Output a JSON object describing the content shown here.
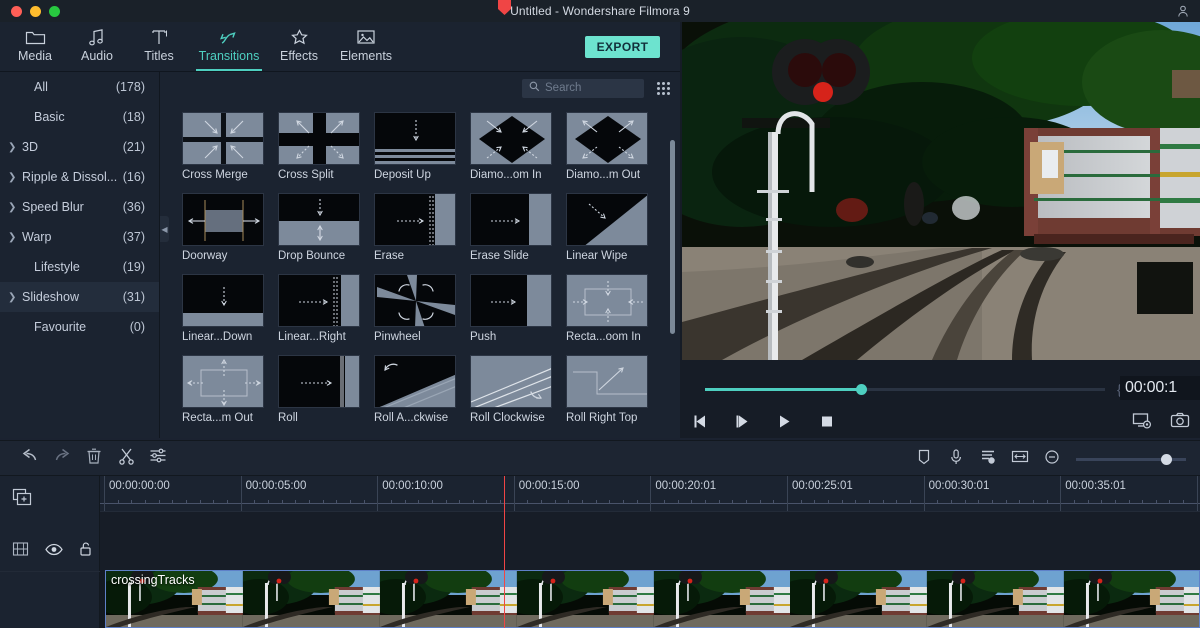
{
  "window": {
    "title": "Untitled - Wondershare Filmora 9",
    "account_icon": "account-icon"
  },
  "nav": {
    "tabs": [
      {
        "label": "Media",
        "icon": "folder-icon",
        "active": false
      },
      {
        "label": "Audio",
        "icon": "music-note-icon",
        "active": false
      },
      {
        "label": "Titles",
        "icon": "text-t-icon",
        "active": false
      },
      {
        "label": "Transitions",
        "icon": "transition-arrows-icon",
        "active": true
      },
      {
        "label": "Effects",
        "icon": "sparkle-icon",
        "active": false
      },
      {
        "label": "Elements",
        "icon": "picture-icon",
        "active": false
      }
    ],
    "export_label": "EXPORT",
    "export_color": "#6de3cf"
  },
  "sidebar": {
    "items": [
      {
        "label": "All",
        "count": "(178)",
        "expandable": false,
        "selected": false
      },
      {
        "label": "Basic",
        "count": "(18)",
        "expandable": false,
        "selected": false
      },
      {
        "label": "3D",
        "count": "(21)",
        "expandable": true,
        "selected": false
      },
      {
        "label": "Ripple & Dissol...",
        "count": "(16)",
        "expandable": true,
        "selected": false
      },
      {
        "label": "Speed Blur",
        "count": "(36)",
        "expandable": true,
        "selected": false
      },
      {
        "label": "Warp",
        "count": "(37)",
        "expandable": true,
        "selected": false
      },
      {
        "label": "Lifestyle",
        "count": "(19)",
        "expandable": false,
        "selected": false
      },
      {
        "label": "Slideshow",
        "count": "(31)",
        "expandable": true,
        "selected": true
      },
      {
        "label": "Favourite",
        "count": "(0)",
        "expandable": false,
        "selected": false
      }
    ]
  },
  "search": {
    "placeholder": "Search",
    "value": ""
  },
  "transitions": [
    {
      "label": "Cross Merge",
      "art": "cross-merge"
    },
    {
      "label": "Cross Split",
      "art": "cross-split"
    },
    {
      "label": "Deposit Up",
      "art": "deposit-up"
    },
    {
      "label": "Diamo...om In",
      "art": "diamond-zoom-in"
    },
    {
      "label": "Diamo...m Out",
      "art": "diamond-zoom-out"
    },
    {
      "label": "Doorway",
      "art": "doorway"
    },
    {
      "label": "Drop Bounce",
      "art": "drop-bounce"
    },
    {
      "label": "Erase",
      "art": "erase"
    },
    {
      "label": "Erase Slide",
      "art": "erase-slide"
    },
    {
      "label": "Linear Wipe",
      "art": "linear-wipe"
    },
    {
      "label": "Linear...Down",
      "art": "linear-down"
    },
    {
      "label": "Linear...Right",
      "art": "linear-right"
    },
    {
      "label": "Pinwheel",
      "art": "pinwheel"
    },
    {
      "label": "Push",
      "art": "push"
    },
    {
      "label": "Recta...oom In",
      "art": "rect-zoom-in"
    },
    {
      "label": "Recta...m Out",
      "art": "rect-zoom-out"
    },
    {
      "label": "Roll",
      "art": "roll"
    },
    {
      "label": "Roll A...ckwise",
      "art": "roll-anticlockwise"
    },
    {
      "label": "Roll Clockwise",
      "art": "roll-clockwise"
    },
    {
      "label": "Roll Right Top",
      "art": "roll-right-top"
    }
  ],
  "preview": {
    "timecode": "00:00:1",
    "seek_percent": 39,
    "accent": "#4ecfc0",
    "mark_in": "{",
    "mark_out": "}",
    "transport": [
      {
        "name": "previous-frame-button",
        "icon": "step-back-icon"
      },
      {
        "name": "next-frame-button",
        "icon": "step-forward-icon"
      },
      {
        "name": "play-button",
        "icon": "play-icon"
      },
      {
        "name": "stop-button",
        "icon": "stop-icon"
      }
    ],
    "right_buttons": [
      {
        "name": "display-settings-button",
        "icon": "monitor-gear-icon"
      },
      {
        "name": "snapshot-button",
        "icon": "camera-icon"
      }
    ]
  },
  "timeline_toolbar": {
    "left_buttons": [
      {
        "name": "undo-button",
        "icon": "undo-arrow-icon"
      },
      {
        "name": "redo-button",
        "icon": "redo-arrow-icon"
      },
      {
        "name": "delete-button",
        "icon": "trash-icon"
      },
      {
        "name": "split-button",
        "icon": "scissors-icon"
      },
      {
        "name": "settings-button",
        "icon": "sliders-icon"
      }
    ],
    "right_buttons": [
      {
        "name": "marker-button",
        "icon": "shield-marker-icon"
      },
      {
        "name": "record-voiceover-button",
        "icon": "microphone-icon"
      },
      {
        "name": "audio-mixer-button",
        "icon": "mixer-icon"
      },
      {
        "name": "fit-timeline-button",
        "icon": "fit-width-icon"
      },
      {
        "name": "zoom-out-button",
        "icon": "minus-circle-icon"
      }
    ],
    "zoom_percent": 78
  },
  "timeline": {
    "add_media_icon": "add-media-icon",
    "track_controls": [
      {
        "name": "track-thumbnail-toggle",
        "icon": "film-grid-icon"
      },
      {
        "name": "track-visibility-toggle",
        "icon": "eye-icon"
      },
      {
        "name": "track-lock-toggle",
        "icon": "unlock-icon"
      }
    ],
    "ruler_labels": [
      "00:00:00:00",
      "00:00:05:00",
      "00:00:10:00",
      "00:00:15:00",
      "00:00:20:01",
      "00:00:25:01",
      "00:00:30:01",
      "00:00:35:01"
    ],
    "playhead_label": "00:00:15:00",
    "clips": [
      {
        "name": "crossingTracks"
      }
    ]
  }
}
